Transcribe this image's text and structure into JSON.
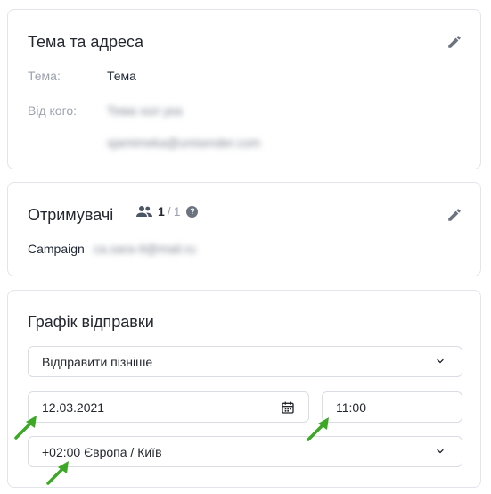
{
  "subject_card": {
    "title": "Тема та адреса",
    "subject_label": "Тема:",
    "subject_value": "Тема",
    "from_label": "Від кого:",
    "from_name": "Тема хол ука",
    "from_email": "sjamimeka@unisender.com"
  },
  "recipients_card": {
    "title": "Отримувачі",
    "count_current": "1",
    "count_separator": "/",
    "count_total": "1",
    "help_glyph": "?",
    "campaign_label": "Campaign",
    "campaign_email": "ca.sara-9@mail.ru"
  },
  "schedule_card": {
    "title": "Графік відправки",
    "send_mode": "Відправити пізніше",
    "date": "12.03.2021",
    "time": "11:00",
    "timezone": "+02:00 Європа / Київ"
  },
  "colors": {
    "annotation_arrow": "#3da726",
    "edit_icon": "#6b7280"
  },
  "icons": [
    "edit-icon",
    "people-icon",
    "help-icon",
    "chevron-down-icon",
    "calendar-icon",
    "green-arrow-annotation"
  ]
}
